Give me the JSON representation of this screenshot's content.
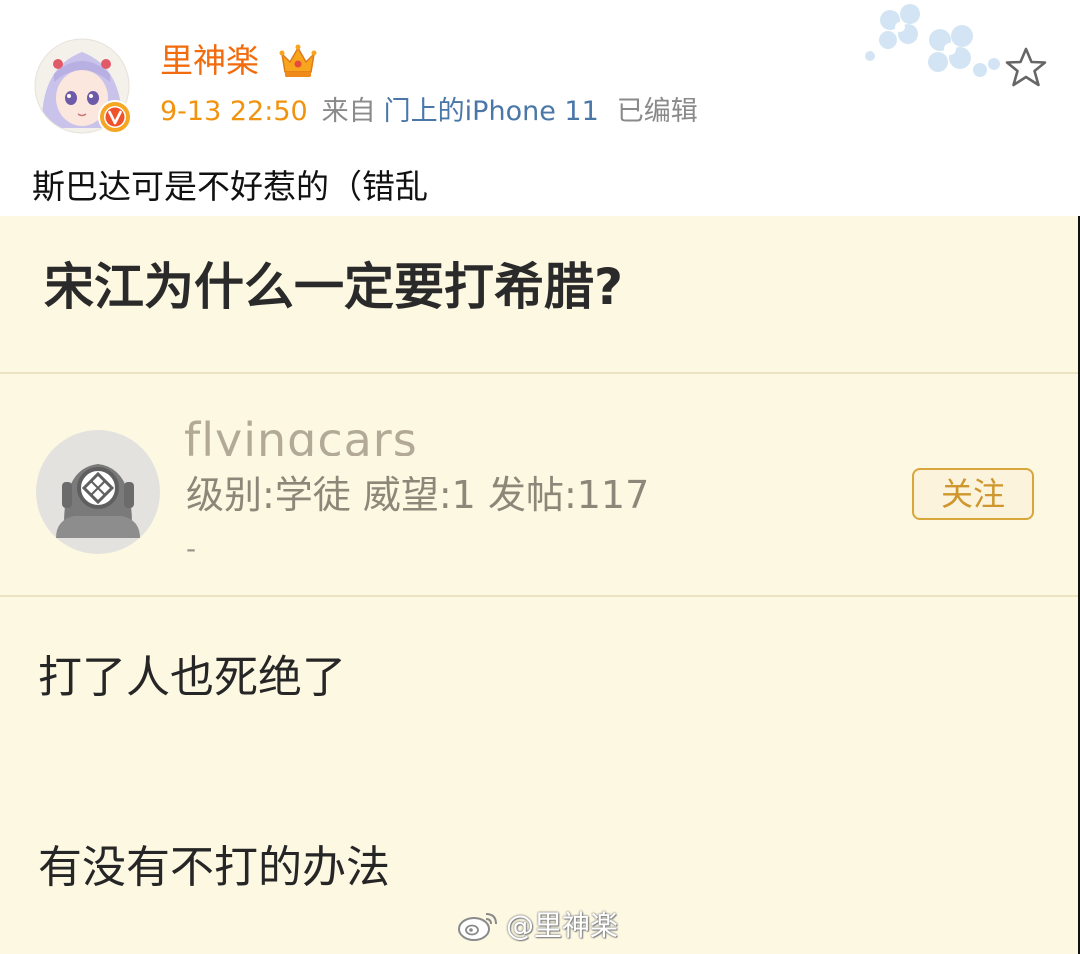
{
  "post": {
    "username": "里神楽",
    "time": "9-13 22:50",
    "from_label": "来自",
    "device": "门上的iPhone 11",
    "edited": "已编辑",
    "text": "斯巴达可是不好惹的（错乱"
  },
  "screenshot": {
    "title": "宋江为什么一定要打希腊?",
    "poster_name": "flyingcars",
    "poster_stats": "级别:学徒 威望:1 发帖:117",
    "poster_extra": "-",
    "follow_label": "关注",
    "reply_lines": [
      "打了人也死绝了",
      "有没有不打的办法"
    ]
  },
  "watermark": {
    "text": "@里神楽"
  },
  "colors": {
    "username": "#f26b0c",
    "time": "#f2930f",
    "device_link": "#4a77a8",
    "screenshot_bg": "#fcf8e2",
    "follow_border": "#d9a63c"
  },
  "icons": {
    "crown": "crown-icon",
    "verified": "verified-v-icon",
    "star": "star-outline-icon",
    "diver_avatar": "diver-helmet-icon",
    "weibo_logo": "weibo-logo-icon"
  }
}
